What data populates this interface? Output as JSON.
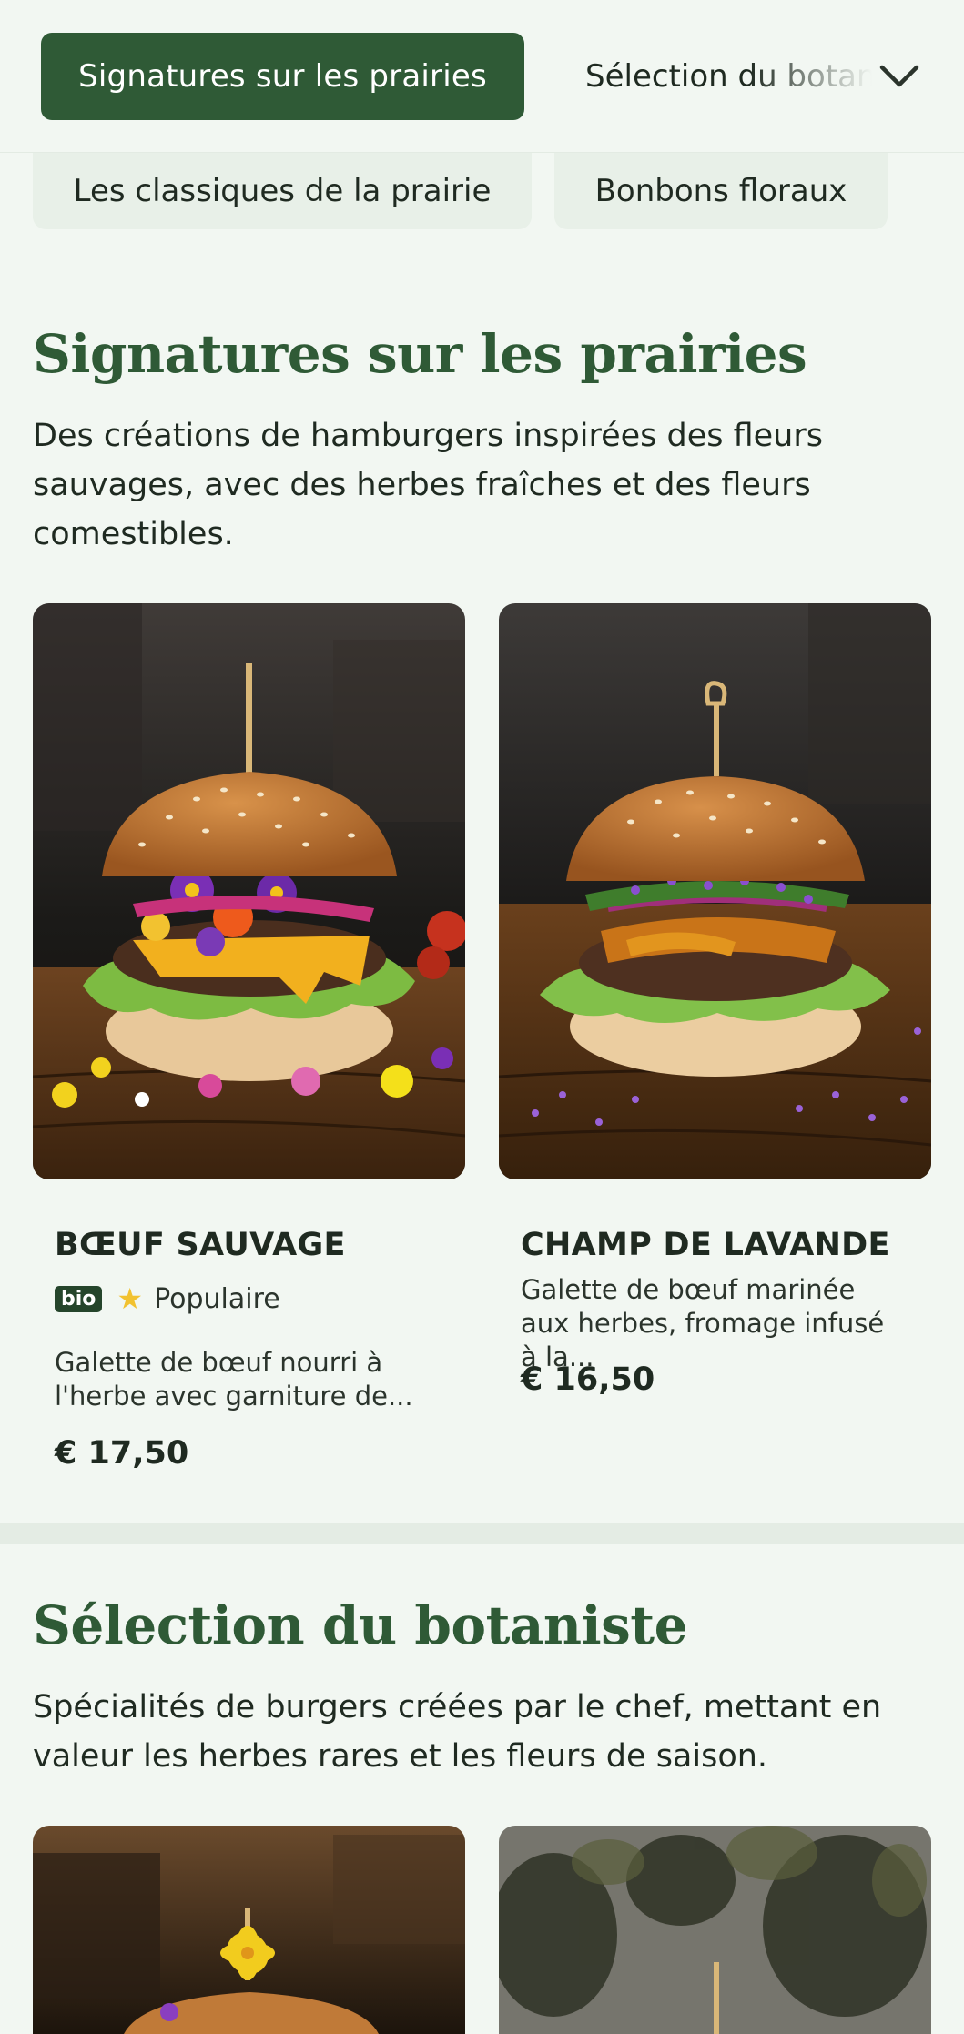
{
  "nav": {
    "active_category": "Signatures sur les prairies",
    "next_category": "Sélection du botaniste",
    "second_row": [
      "Les classiques de la prairie",
      "Bonbons floraux"
    ]
  },
  "sections": [
    {
      "title": "Signatures sur les prairies",
      "description": "Des créations de hamburgers inspirées des fleurs sauvages, avec des herbes fraîches et des fleurs comestibles.",
      "items": [
        {
          "name": "BŒUF SAUVAGE",
          "badge": "bio",
          "tag": "Populaire",
          "description": "Galette de bœuf nourri à l'herbe avec garniture de...",
          "price": "€ 17,50",
          "image_icon": "burger-wildflower-photo"
        },
        {
          "name": "CHAMP DE LAVANDE",
          "description": "Galette de bœuf marinée aux herbes, fromage infusé à la...",
          "price": "€ 16,50",
          "image_icon": "burger-lavender-photo"
        }
      ]
    },
    {
      "title": "Sélection du botaniste",
      "description": "Spécialités de burgers créées par le chef, mettant en valeur les herbes rares et les fleurs de saison."
    }
  ],
  "colors": {
    "accent": "#2f5a36",
    "background": "#f2f7f2",
    "star": "#f2c230"
  },
  "icons": [
    "chevron-down-icon",
    "star-icon"
  ]
}
